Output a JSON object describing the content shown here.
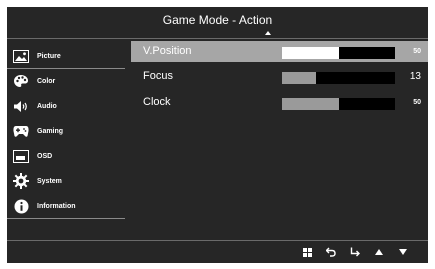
{
  "header": {
    "title": "Game Mode - Action"
  },
  "sidebar": {
    "items": [
      {
        "label": "Picture",
        "icon": "picture-icon"
      },
      {
        "label": "Color",
        "icon": "palette-icon"
      },
      {
        "label": "Audio",
        "icon": "speaker-icon"
      },
      {
        "label": "Gaming",
        "icon": "gamepad-icon"
      },
      {
        "label": "OSD",
        "icon": "osd-window-icon"
      },
      {
        "label": "System",
        "icon": "gear-icon"
      },
      {
        "label": "Information",
        "icon": "info-icon"
      }
    ]
  },
  "settings": [
    {
      "label": "V.Position",
      "value": "50",
      "fill": 0.5,
      "selected": true
    },
    {
      "label": "Focus",
      "value": "13",
      "fill": 0.3,
      "selected": false
    },
    {
      "label": "Clock",
      "value": "50",
      "fill": 0.5,
      "selected": false
    }
  ],
  "footer": {
    "buttons": [
      "menu-grid-icon",
      "back-icon",
      "enter-icon",
      "up-arrow-icon",
      "down-arrow-icon"
    ]
  },
  "colors": {
    "panel": "#262626",
    "selected_row": "#a6a6a6",
    "bar_fill": "#9a9a9a",
    "bar_track": "#000000"
  }
}
